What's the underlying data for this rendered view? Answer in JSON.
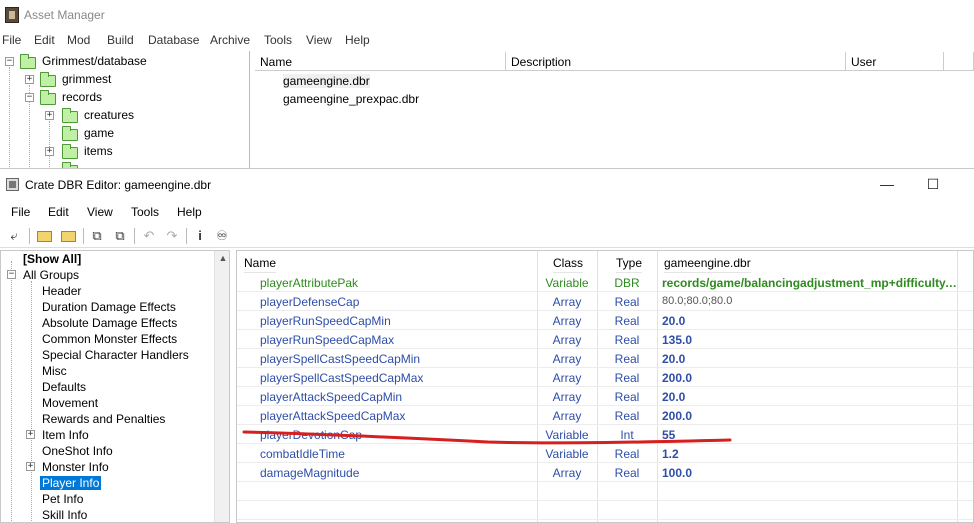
{
  "asset_manager": {
    "title": "Asset Manager",
    "menu": [
      "File",
      "Edit",
      "Mod",
      "Build",
      "Database",
      "Archive",
      "Tools",
      "View",
      "Help"
    ],
    "tree": [
      {
        "label": "Grimmest/database",
        "expander": "−"
      },
      {
        "label": "grimmest",
        "expander": "+"
      },
      {
        "label": "records",
        "expander": "−"
      },
      {
        "label": "creatures",
        "expander": "+"
      },
      {
        "label": "game",
        "expander": ""
      },
      {
        "label": "items",
        "expander": "+"
      }
    ],
    "list_headers": [
      "Name",
      "Description",
      "User"
    ],
    "files": [
      "gameengine.dbr",
      "gameengine_prexpac.dbr"
    ]
  },
  "dbr_editor": {
    "title": "Crate DBR Editor: gameengine.dbr",
    "window_controls": {
      "minimize": "—",
      "maximize": "☐"
    },
    "menu": [
      "File",
      "Edit",
      "View",
      "Tools",
      "Help"
    ],
    "toolbar": [
      "open-icon",
      "folder-icon",
      "folder-icon",
      "copy-icon",
      "paste-icon",
      "undo-icon",
      "redo-icon",
      "info-icon",
      "find-icon"
    ],
    "groups": {
      "show_all": "[Show All]",
      "root": "All Groups",
      "root_expander": "−",
      "items": [
        {
          "label": "Header",
          "expander": ""
        },
        {
          "label": "Duration Damage Effects",
          "expander": ""
        },
        {
          "label": "Absolute Damage Effects",
          "expander": ""
        },
        {
          "label": "Common Monster Effects",
          "expander": ""
        },
        {
          "label": "Special Character Handlers",
          "expander": ""
        },
        {
          "label": "Misc",
          "expander": ""
        },
        {
          "label": "Defaults",
          "expander": ""
        },
        {
          "label": "Movement",
          "expander": ""
        },
        {
          "label": "Rewards and Penalties",
          "expander": ""
        },
        {
          "label": "Item Info",
          "expander": "+"
        },
        {
          "label": "OneShot Info",
          "expander": ""
        },
        {
          "label": "Monster Info",
          "expander": "+"
        },
        {
          "label": "Player Info",
          "expander": "",
          "selected": true
        },
        {
          "label": "Pet Info",
          "expander": ""
        },
        {
          "label": "Skill Info",
          "expander": ""
        }
      ]
    },
    "grid": {
      "headers": [
        "Name",
        "Class",
        "Type",
        "gameengine.dbr"
      ],
      "rows": [
        {
          "name": "playerAttributePak",
          "class": "Variable",
          "type": "DBR",
          "value": "records/game/balancingadjustment_mp+difficulty.dbr",
          "style": "green"
        },
        {
          "name": "playerDefenseCap",
          "class": "Array",
          "type": "Real",
          "value": "80.0;80.0;80.0",
          "style": "gray"
        },
        {
          "name": "playerRunSpeedCapMin",
          "class": "Array",
          "type": "Real",
          "value": "20.0",
          "style": "blue"
        },
        {
          "name": "playerRunSpeedCapMax",
          "class": "Array",
          "type": "Real",
          "value": "135.0",
          "style": "blue"
        },
        {
          "name": "playerSpellCastSpeedCapMin",
          "class": "Array",
          "type": "Real",
          "value": "20.0",
          "style": "blue"
        },
        {
          "name": "playerSpellCastSpeedCapMax",
          "class": "Array",
          "type": "Real",
          "value": "200.0",
          "style": "blue"
        },
        {
          "name": "playerAttackSpeedCapMin",
          "class": "Array",
          "type": "Real",
          "value": "20.0",
          "style": "blue"
        },
        {
          "name": "playerAttackSpeedCapMax",
          "class": "Array",
          "type": "Real",
          "value": "200.0",
          "style": "blue"
        },
        {
          "name": "playerDevotionCap",
          "class": "Variable",
          "type": "Int",
          "value": "55",
          "style": "blue"
        },
        {
          "name": "combatIdleTime",
          "class": "Variable",
          "type": "Real",
          "value": "1.2",
          "style": "blue"
        },
        {
          "name": "damageMagnitude",
          "class": "Array",
          "type": "Real",
          "value": "100.0",
          "style": "blue"
        }
      ]
    },
    "annotation_color": "#d42020"
  }
}
